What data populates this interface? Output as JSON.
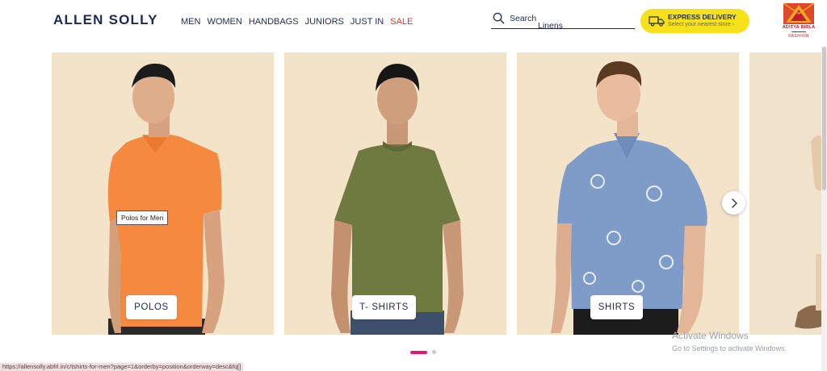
{
  "header": {
    "logo": "ALLEN SOLLY",
    "nav": [
      "MEN",
      "WOMEN",
      "HANDBAGS",
      "JUNIORS",
      "JUST IN",
      "SALE"
    ],
    "search": {
      "label": "Search",
      "value": "Linens"
    },
    "express": {
      "title": "EXPRESS DELIVERY",
      "subtitle": "Select your nearest store ›"
    },
    "brand": {
      "name": "ADITYA BIRLA",
      "sub": "FASHION"
    }
  },
  "carousel": {
    "cards": [
      {
        "label": "POLOS",
        "shirt_color": "#f5893f"
      },
      {
        "label": "T- SHIRTS",
        "shirt_color": "#6e7a40"
      },
      {
        "label": "SHIRTS",
        "shirt_color": "#7f9cc9"
      }
    ],
    "tooltip": "Polos for Men",
    "active_slide": 1,
    "slide_count": 2
  },
  "status_bar": {
    "url": "https://allensolly.abfrl.in/c/tshirts-for-men?page=1&orderby=position&orderway=desc&fq[]"
  },
  "watermark": {
    "title": "Activate Windows",
    "subtitle": "Go to Settings to activate Windows."
  },
  "colors": {
    "accent": "#e8167b",
    "sale": "#e4312b",
    "express_bg": "#f7e11b",
    "card_bg": "#f3e3c9",
    "brand_red": "#b81d2a"
  }
}
